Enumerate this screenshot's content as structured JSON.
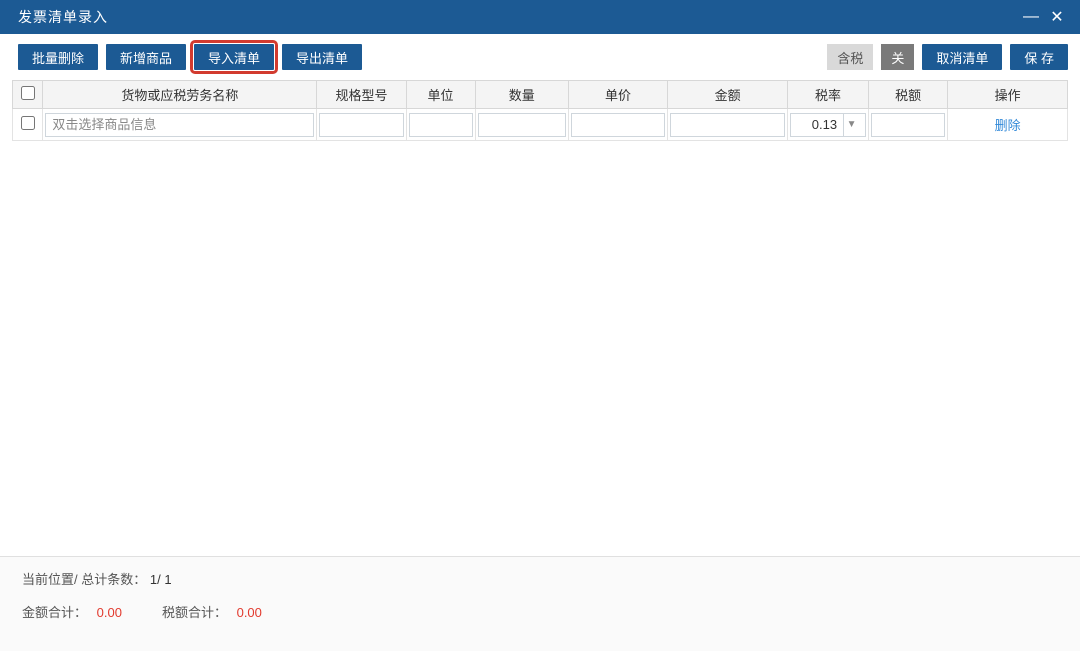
{
  "titlebar": {
    "title": "发票清单录入"
  },
  "toolbar": {
    "batch_delete": "批量删除",
    "add_product": "新增商品",
    "import_list": "导入清单",
    "export_list": "导出清单",
    "tax_included": "含税",
    "toggle_off": "关",
    "cancel_list": "取消清单",
    "save": "保 存"
  },
  "columns": {
    "name": "货物或应税劳务名称",
    "spec": "规格型号",
    "unit": "单位",
    "qty": "数量",
    "price": "单价",
    "amount": "金额",
    "rate": "税率",
    "tax": "税额",
    "op": "操作"
  },
  "row": {
    "name_placeholder": "双击选择商品信息",
    "rate_value": "0.13",
    "delete_label": "删除"
  },
  "footer": {
    "pos_label": "当前位置/ 总计条数：",
    "pos_value": "1/ 1",
    "amount_total_label": "金额合计：",
    "amount_total_value": "0.00",
    "tax_total_label": "税额合计：",
    "tax_total_value": "0.00"
  }
}
